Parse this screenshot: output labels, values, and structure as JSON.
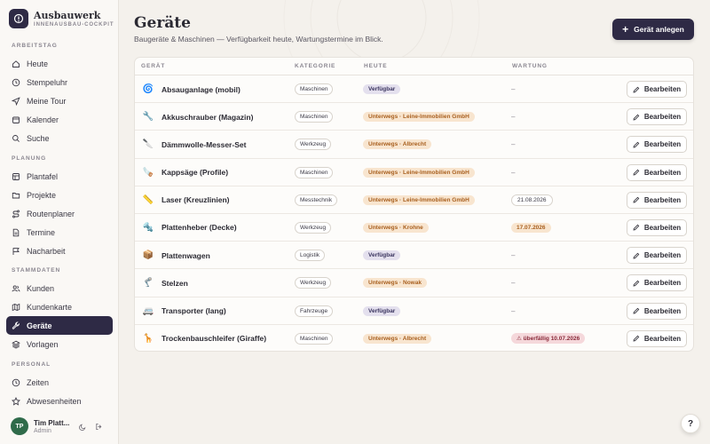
{
  "brand": {
    "name": "Ausbauwerk",
    "subtitle": "INNENAUSBAU-COCKPIT"
  },
  "nav": [
    {
      "heading": "ARBEITSTAG",
      "items": [
        {
          "label": "Heute",
          "icon": "home-icon"
        },
        {
          "label": "Stempeluhr",
          "icon": "clock-icon"
        },
        {
          "label": "Meine Tour",
          "icon": "navigation-icon"
        },
        {
          "label": "Kalender",
          "icon": "calendar-icon"
        },
        {
          "label": "Suche",
          "icon": "search-icon"
        }
      ]
    },
    {
      "heading": "PLANUNG",
      "items": [
        {
          "label": "Plantafel",
          "icon": "board-icon"
        },
        {
          "label": "Projekte",
          "icon": "folder-icon"
        },
        {
          "label": "Routenplaner",
          "icon": "route-icon"
        },
        {
          "label": "Termine",
          "icon": "document-icon"
        },
        {
          "label": "Nacharbeit",
          "icon": "flag-icon"
        }
      ]
    },
    {
      "heading": "STAMMDATEN",
      "items": [
        {
          "label": "Kunden",
          "icon": "users-icon"
        },
        {
          "label": "Kundenkarte",
          "icon": "map-icon"
        },
        {
          "label": "Geräte",
          "icon": "tool-icon",
          "active": true
        },
        {
          "label": "Vorlagen",
          "icon": "layers-icon"
        }
      ]
    },
    {
      "heading": "PERSONAL",
      "items": [
        {
          "label": "Zeiten",
          "icon": "clock-icon"
        },
        {
          "label": "Abwesenheiten",
          "icon": "star-icon"
        }
      ]
    }
  ],
  "user": {
    "initials": "TP",
    "name": "Tim Platt...",
    "role": "Admin"
  },
  "page": {
    "title": "Geräte",
    "subtitle": "Baugeräte & Maschinen — Verfügbarkeit heute, Wartungstermine im Blick.",
    "primary_button": "Gerät anlegen"
  },
  "table": {
    "headers": {
      "name": "GERÄT",
      "category": "KATEGORIE",
      "status": "HEUTE",
      "maintenance": "WARTUNG"
    },
    "edit_label": "Bearbeiten",
    "rows": [
      {
        "emoji": "🌀",
        "name": "Absauganlage (mobil)",
        "category": "Maschinen",
        "status": "Verfügbar",
        "status_type": "free",
        "maintenance": "–",
        "maint_type": "none"
      },
      {
        "emoji": "🔧",
        "name": "Akkuschrauber (Magazin)",
        "category": "Maschinen",
        "status": "Unterwegs · Leine-Immobilien GmbH",
        "status_type": "away",
        "maintenance": "–",
        "maint_type": "none"
      },
      {
        "emoji": "🔪",
        "name": "Dämmwolle-Messer-Set",
        "category": "Werkzeug",
        "status": "Unterwegs · Albrecht",
        "status_type": "away",
        "maintenance": "–",
        "maint_type": "none"
      },
      {
        "emoji": "🪚",
        "name": "Kappsäge (Profile)",
        "category": "Maschinen",
        "status": "Unterwegs · Leine-Immobilien GmbH",
        "status_type": "away",
        "maintenance": "–",
        "maint_type": "none"
      },
      {
        "emoji": "📏",
        "name": "Laser (Kreuzlinien)",
        "category": "Messtechnik",
        "status": "Unterwegs · Leine-Immobilien GmbH",
        "status_type": "away",
        "maintenance": "21.08.2026",
        "maint_type": "date"
      },
      {
        "emoji": "🔩",
        "name": "Plattenheber (Decke)",
        "category": "Werkzeug",
        "status": "Unterwegs · Krohne",
        "status_type": "away",
        "maintenance": "17.07.2026",
        "maint_type": "warm"
      },
      {
        "emoji": "📦",
        "name": "Plattenwagen",
        "category": "Logistik",
        "status": "Verfügbar",
        "status_type": "free",
        "maintenance": "–",
        "maint_type": "none"
      },
      {
        "emoji": "🦿",
        "name": "Stelzen",
        "category": "Werkzeug",
        "status": "Unterwegs · Nowak",
        "status_type": "away",
        "maintenance": "–",
        "maint_type": "none"
      },
      {
        "emoji": "🚐",
        "name": "Transporter (lang)",
        "category": "Fahrzeuge",
        "status": "Verfügbar",
        "status_type": "free",
        "maintenance": "–",
        "maint_type": "none"
      },
      {
        "emoji": "🦒",
        "name": "Trockenbauschleifer (Giraffe)",
        "category": "Maschinen",
        "status": "Unterwegs · Albrecht",
        "status_type": "away",
        "maintenance": "⚠ überfällig 10.07.2026",
        "maint_type": "overdue"
      }
    ]
  },
  "help_label": "?"
}
